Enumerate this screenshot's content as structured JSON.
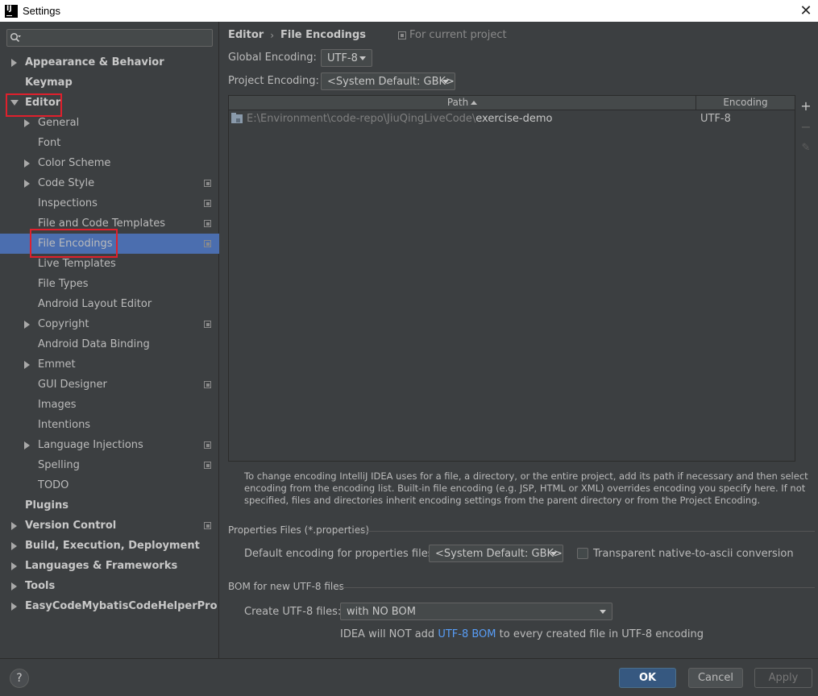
{
  "window": {
    "title": "Settings",
    "close_glyph": "✕"
  },
  "search": {
    "placeholder": "",
    "value": ""
  },
  "tree": [
    {
      "label": "Appearance & Behavior",
      "level": 0,
      "bold": true,
      "arrow": "right",
      "copy": false
    },
    {
      "label": "Keymap",
      "level": 0,
      "bold": true,
      "arrow": "none",
      "copy": false
    },
    {
      "label": "Editor",
      "level": 0,
      "bold": true,
      "arrow": "down",
      "copy": false
    },
    {
      "label": "General",
      "level": 1,
      "bold": false,
      "arrow": "right",
      "copy": false
    },
    {
      "label": "Font",
      "level": 1,
      "bold": false,
      "arrow": "none",
      "copy": false
    },
    {
      "label": "Color Scheme",
      "level": 1,
      "bold": false,
      "arrow": "right",
      "copy": false
    },
    {
      "label": "Code Style",
      "level": 1,
      "bold": false,
      "arrow": "right",
      "copy": true
    },
    {
      "label": "Inspections",
      "level": 1,
      "bold": false,
      "arrow": "none",
      "copy": true
    },
    {
      "label": "File and Code Templates",
      "level": 1,
      "bold": false,
      "arrow": "none",
      "copy": true
    },
    {
      "label": "File Encodings",
      "level": 1,
      "bold": false,
      "arrow": "none",
      "copy": true,
      "selected": true
    },
    {
      "label": "Live Templates",
      "level": 1,
      "bold": false,
      "arrow": "none",
      "copy": false
    },
    {
      "label": "File Types",
      "level": 1,
      "bold": false,
      "arrow": "none",
      "copy": false
    },
    {
      "label": "Android Layout Editor",
      "level": 1,
      "bold": false,
      "arrow": "none",
      "copy": false
    },
    {
      "label": "Copyright",
      "level": 1,
      "bold": false,
      "arrow": "right",
      "copy": true
    },
    {
      "label": "Android Data Binding",
      "level": 1,
      "bold": false,
      "arrow": "none",
      "copy": false
    },
    {
      "label": "Emmet",
      "level": 1,
      "bold": false,
      "arrow": "right",
      "copy": false
    },
    {
      "label": "GUI Designer",
      "level": 1,
      "bold": false,
      "arrow": "none",
      "copy": true
    },
    {
      "label": "Images",
      "level": 1,
      "bold": false,
      "arrow": "none",
      "copy": false
    },
    {
      "label": "Intentions",
      "level": 1,
      "bold": false,
      "arrow": "none",
      "copy": false
    },
    {
      "label": "Language Injections",
      "level": 1,
      "bold": false,
      "arrow": "right",
      "copy": true
    },
    {
      "label": "Spelling",
      "level": 1,
      "bold": false,
      "arrow": "none",
      "copy": true
    },
    {
      "label": "TODO",
      "level": 1,
      "bold": false,
      "arrow": "none",
      "copy": false
    },
    {
      "label": "Plugins",
      "level": 0,
      "bold": true,
      "arrow": "none",
      "copy": false
    },
    {
      "label": "Version Control",
      "level": 0,
      "bold": true,
      "arrow": "right",
      "copy": true
    },
    {
      "label": "Build, Execution, Deployment",
      "level": 0,
      "bold": true,
      "arrow": "right",
      "copy": false
    },
    {
      "label": "Languages & Frameworks",
      "level": 0,
      "bold": true,
      "arrow": "right",
      "copy": false
    },
    {
      "label": "Tools",
      "level": 0,
      "bold": true,
      "arrow": "right",
      "copy": false
    },
    {
      "label": "EasyCodeMybatisCodeHelperPro",
      "level": 0,
      "bold": true,
      "arrow": "right",
      "copy": false
    }
  ],
  "main": {
    "breadcrumb": {
      "parent": "Editor",
      "separator": "›",
      "current": "File Encodings",
      "scope": "For current project"
    },
    "global_encoding": {
      "label": "Global Encoding:",
      "value": "UTF-8"
    },
    "project_encoding": {
      "label": "Project Encoding:",
      "value": "<System Default: GBK>"
    },
    "table": {
      "columns": {
        "path": "Path",
        "encoding": "Encoding"
      },
      "rows": [
        {
          "path_prefix": "E:\\Environment\\code-repo\\JiuQingLiveCode\\",
          "path_name": "exercise-demo",
          "encoding": "UTF-8"
        }
      ]
    },
    "tools": {
      "add": "+",
      "remove": "−",
      "edit": "✎"
    },
    "description": "To change encoding IntelliJ IDEA uses for a file, a directory, or the entire project, add its path if necessary and then select encoding from the encoding list. Built-in file encoding (e.g. JSP, HTML or XML) overrides encoding you specify here. If not specified, files and directories inherit encoding settings from the parent directory or from the Project Encoding.",
    "properties": {
      "section_title": "Properties Files (*.properties)",
      "default_label": "Default encoding for properties files:",
      "default_value": "<System Default: GBK>",
      "transparent_label": "Transparent native-to-ascii conversion",
      "transparent_checked": false
    },
    "bom": {
      "section_title": "BOM for new UTF-8 files",
      "create_label": "Create UTF-8 files:",
      "create_value": "with NO BOM",
      "note_before": "IDEA will NOT add ",
      "note_link": "UTF-8 BOM",
      "note_after": " to every created file in UTF-8 encoding"
    }
  },
  "buttons": {
    "help": "?",
    "ok": "OK",
    "cancel": "Cancel",
    "apply": "Apply"
  },
  "colors": {
    "background": "#3c3f41",
    "selection": "#4b6eaf",
    "highlight_box": "#e0202c",
    "link": "#589df6",
    "ok_button": "#365880"
  }
}
